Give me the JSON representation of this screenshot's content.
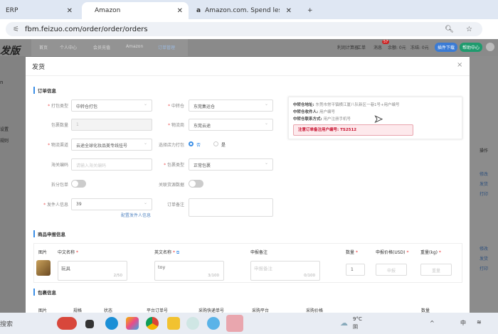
{
  "browser": {
    "tabs": [
      {
        "label": "ERP"
      },
      {
        "label": "Amazon"
      },
      {
        "label": "Amazon.com. Spend less. Sm"
      }
    ],
    "new_tab": "+",
    "url": "fbm.feizuo.com/order/order/orders"
  },
  "app": {
    "logo": "发版",
    "nav": [
      "首页",
      "个人中心",
      "会员充值",
      "Amazon",
      "订单管理"
    ],
    "right": {
      "calc": "利润计算器",
      "ticket": "工单",
      "message": "消息",
      "badge": "57",
      "balance": "余额: 0元",
      "frozen": "冻结: 0元",
      "download": "插件下载",
      "help": "帮助中心"
    },
    "sidebar": [
      "n",
      "设置",
      "规则"
    ]
  },
  "modal": {
    "title": "发货",
    "close": "×",
    "order_section": "订单信息",
    "fields": {
      "pack_type_label": "打包类型",
      "pack_type": "中转仓打包",
      "warehouse_label": "中转仓",
      "warehouse": "东莞集运仓",
      "pkg_count_label": "包裹数量",
      "pkg_count": "1",
      "logistics_label": "物流商",
      "logistics": "东莞云途",
      "channel_label": "物流渠道",
      "channel": "云途全球化妆品美专线挂号",
      "manual_pack_label": "选择店力打包",
      "opt_no": "否",
      "opt_yes": "是",
      "customs_label": "海关编码",
      "customs_placeholder": "请输入海关编码",
      "parcel_type_label": "包裹类型",
      "parcel_type": "正常包裹",
      "split_label": "拆分包单",
      "link_label": "关联货源数据",
      "sender_label": "发件人信息",
      "sender": "39",
      "sender_link": "配置发件人信息",
      "remark_label": "订单备注"
    },
    "warehouse_info": {
      "addr_label": "中转仓地址:",
      "addr": "东莞市常平镇横江厦八队新区一巷1号+用户编号",
      "recv_label": "中转仓收件人:",
      "recv": "用户编号",
      "contact_label": "中转仓联系方式:",
      "contact": "用户注册手机号",
      "notice": "注意订单备注用户编号: TS2512"
    },
    "declare_section": "商品申报信息",
    "declare_headers": [
      "图片",
      "中文名称",
      "英文名称",
      "申报备注",
      "数量",
      "申报价格(USD)",
      "重量(kg)"
    ],
    "declare_row": {
      "cn": "玩具",
      "cn_count": "2/50",
      "en": "toy",
      "en_count": "3/100",
      "remark_placeholder": "申报备注",
      "remark_count": "0/100",
      "qty": "1",
      "price_placeholder": "申报",
      "weight_placeholder": "重量"
    },
    "package_section": "包裹信息",
    "package_headers": [
      "图片",
      "规格",
      "状态",
      "平台订单号",
      "采购快递单号",
      "采购平台",
      "采购价格",
      "数量"
    ]
  },
  "background": {
    "ops_header": "操作",
    "actions": [
      "修改",
      "发货",
      "打印"
    ]
  },
  "taskbar": {
    "search": "搜索",
    "weather_temp": "9°C",
    "weather": "阴",
    "ime": "中"
  }
}
